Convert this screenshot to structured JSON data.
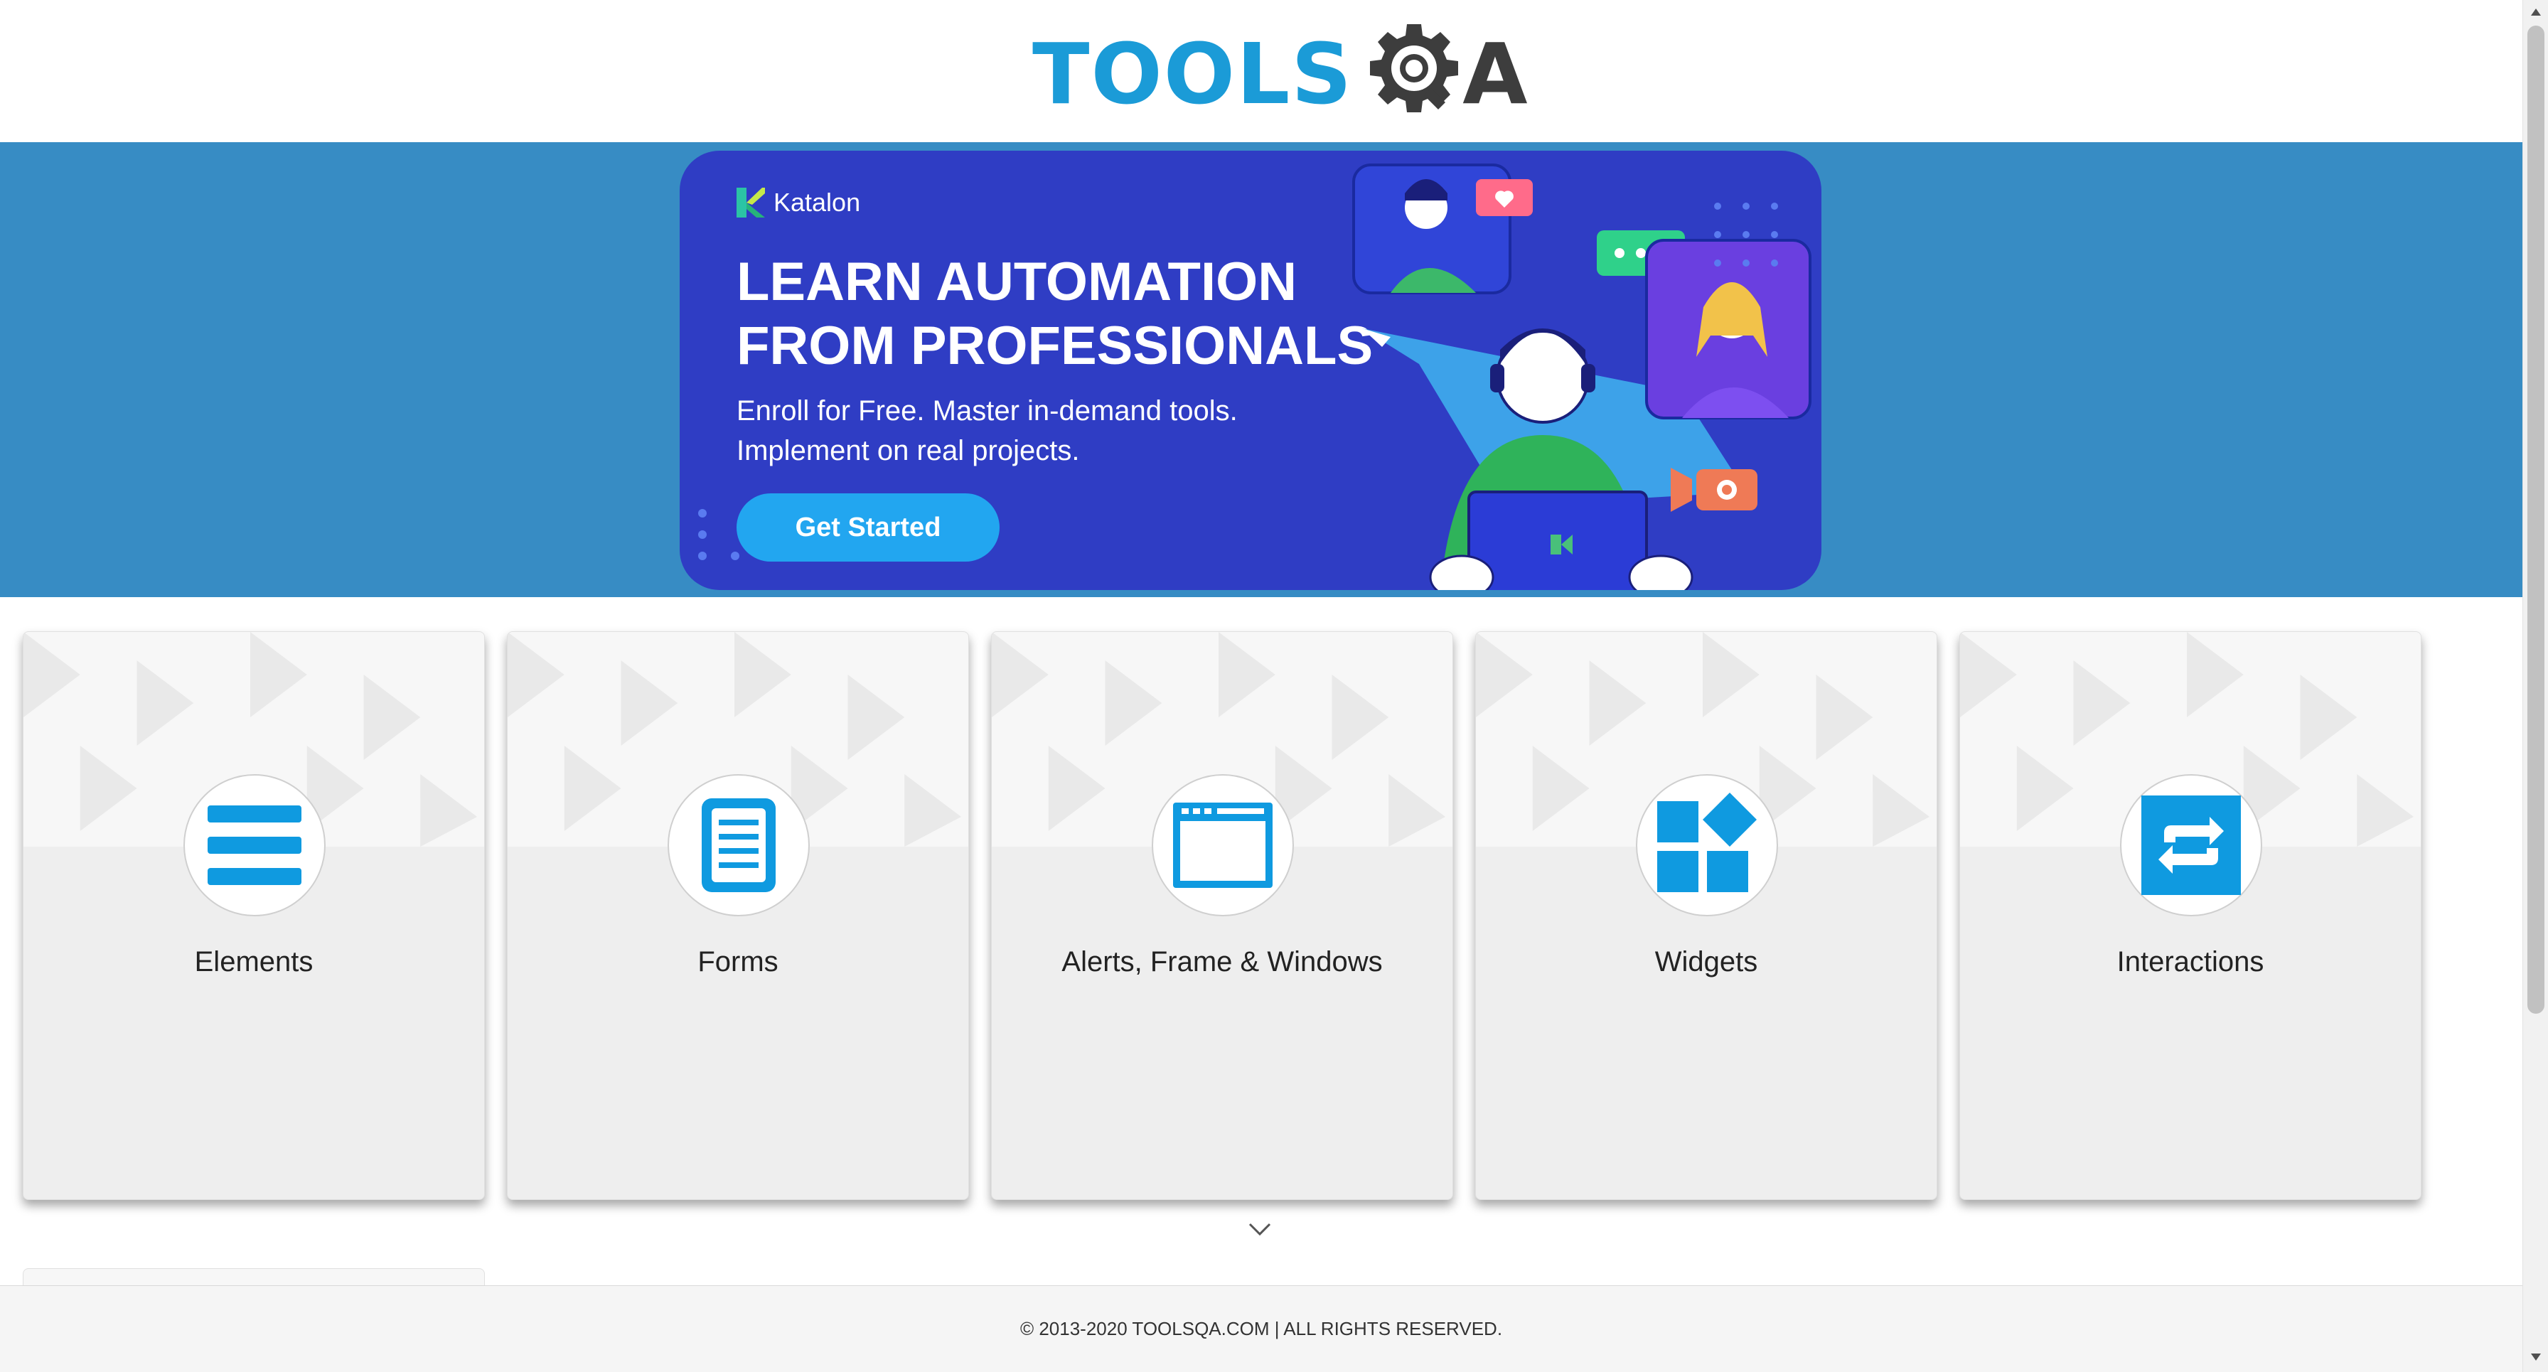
{
  "header": {
    "logo_text_main": "TOOLS",
    "logo_text_end": "A"
  },
  "banner": {
    "brand": "Katalon",
    "title_line1": "LEARN AUTOMATION",
    "title_line2": "FROM PROFESSIONALS",
    "subtitle_line1": "Enroll for Free. Master in-demand tools.",
    "subtitle_line2": "Implement on real projects.",
    "cta_label": "Get Started",
    "colors": {
      "strip": "#378cc4",
      "panel": "#2f3dc4",
      "cta": "#22a6f0"
    }
  },
  "cards": [
    {
      "label": "Elements",
      "icon": "hamburger-menu-icon"
    },
    {
      "label": "Forms",
      "icon": "document-icon"
    },
    {
      "label": "Alerts, Frame & Windows",
      "icon": "browser-window-icon"
    },
    {
      "label": "Widgets",
      "icon": "widgets-grid-icon"
    },
    {
      "label": "Interactions",
      "icon": "swap-arrows-icon"
    }
  ],
  "accent_color": "#1b9bd7",
  "footer": {
    "text": "© 2013-2020 TOOLSQA.COM | ALL RIGHTS RESERVED."
  }
}
